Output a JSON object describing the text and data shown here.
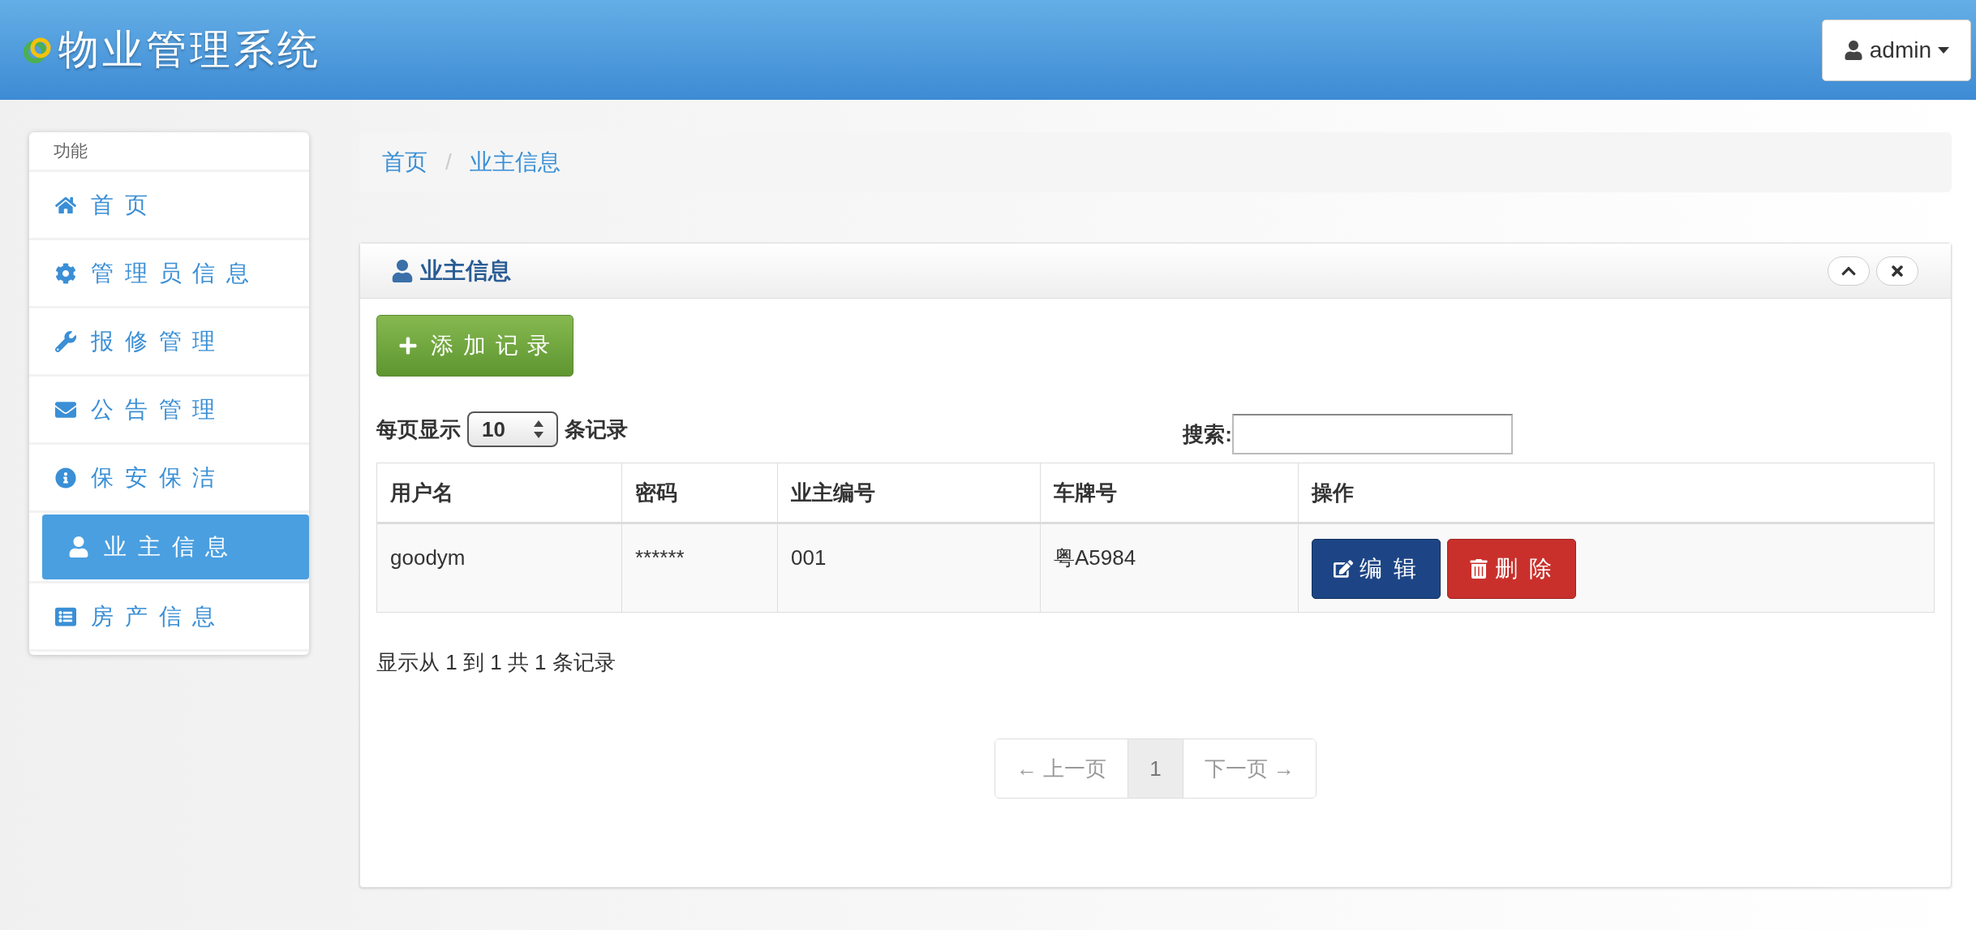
{
  "header": {
    "title": "物业管理系统",
    "user": "admin"
  },
  "sidebar": {
    "heading": "功能",
    "items": [
      {
        "label": "首 页",
        "selected": false
      },
      {
        "label": "管 理 员 信 息",
        "selected": false
      },
      {
        "label": "报 修 管 理",
        "selected": false
      },
      {
        "label": "公 告 管 理",
        "selected": false
      },
      {
        "label": "保 安 保 洁",
        "selected": false
      },
      {
        "label": "业 主 信 息",
        "selected": true
      },
      {
        "label": "房 产 信 息",
        "selected": false
      }
    ]
  },
  "breadcrumb": {
    "separator": "/",
    "items": [
      "首页",
      "业主信息"
    ]
  },
  "panel": {
    "title": "业主信息",
    "add_button": "添 加 记 录",
    "page_size": {
      "prefix": "每页显示",
      "value": "10",
      "suffix": "条记录"
    },
    "search": {
      "label": "搜索:"
    },
    "table": {
      "columns": [
        "用户名",
        "密码",
        "业主编号",
        "车牌号",
        "操作"
      ],
      "rows": [
        {
          "cells": [
            "goodym",
            "******",
            "001",
            "粤A5984"
          ],
          "actions": [
            "编 辑",
            "删 除"
          ]
        }
      ]
    },
    "summary": "显示从 1 到 1 共 1 条记录",
    "pagination": [
      {
        "label": "← 上一页",
        "selected": false
      },
      {
        "label": "1",
        "selected": true
      },
      {
        "label": "下一页 →",
        "selected": false
      }
    ]
  }
}
